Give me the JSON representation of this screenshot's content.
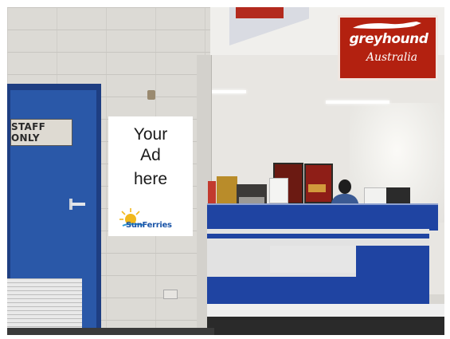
{
  "scene": {
    "description_type": "photo",
    "colors": {
      "door_blue": "#2a58a8",
      "counter_blue": "#1f44a2",
      "greyhound_red": "#b32110"
    }
  },
  "door_sign": {
    "text": "STAFF ONLY"
  },
  "ad_poster": {
    "lines": [
      "Your",
      "Ad",
      "here"
    ],
    "logo_text": "SunFerries"
  },
  "company_sign": {
    "brand": "greyhound",
    "subtitle": "Australia"
  }
}
